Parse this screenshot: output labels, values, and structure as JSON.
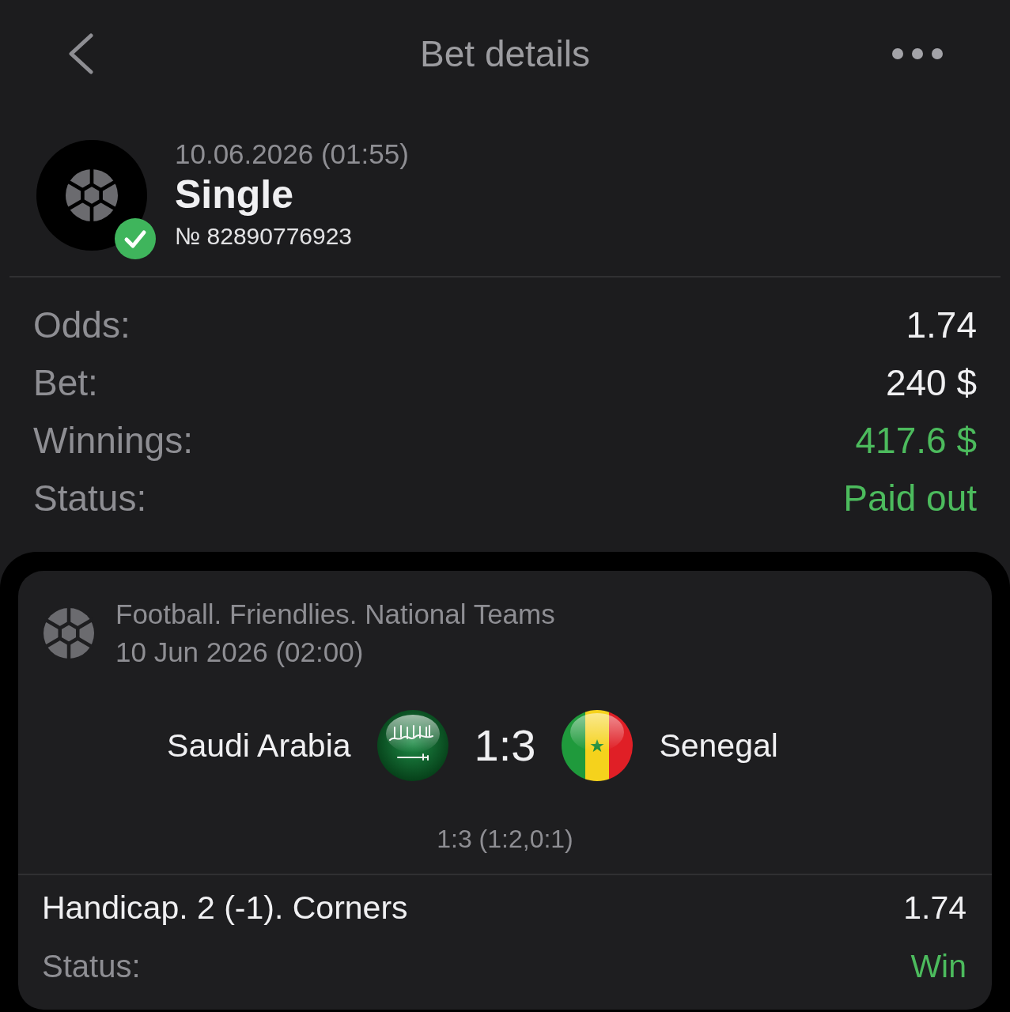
{
  "header": {
    "title": "Bet details"
  },
  "ticket": {
    "date": "10.06.2026 (01:55)",
    "type": "Single",
    "number": "№ 82890776923",
    "settled": true
  },
  "summary": [
    {
      "label": "Odds:",
      "value": "1.74",
      "positive": false
    },
    {
      "label": "Bet:",
      "value": "240 $",
      "positive": false
    },
    {
      "label": "Winnings:",
      "value": "417.6 $",
      "positive": true
    },
    {
      "label": "Status:",
      "value": "Paid out",
      "positive": true
    }
  ],
  "event": {
    "league": "Football. Friendlies. National Teams",
    "date": "10 Jun 2026 (02:00)",
    "home": "Saudi Arabia",
    "score": "1:3",
    "away": "Senegal",
    "periods": "1:3 (1:2,0:1)"
  },
  "selection": {
    "market": "Handicap. 2 (-1). Corners",
    "odds": "1.74",
    "status_label": "Status:",
    "status": "Win",
    "positive": true
  }
}
